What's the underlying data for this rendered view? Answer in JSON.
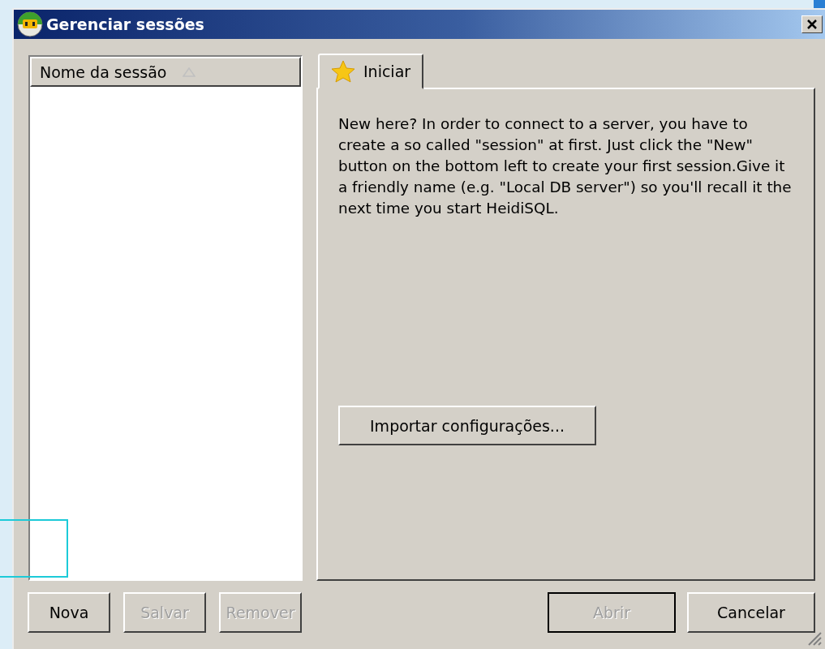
{
  "window": {
    "title": "Gerenciar sessões"
  },
  "session_list": {
    "columns": [
      {
        "label": "Nome da sessão",
        "sorted_ascending": true
      }
    ]
  },
  "tabs": [
    {
      "label": "Iniciar",
      "selected": true
    }
  ],
  "intro_text": "New here? In order to connect to a server, you have to create a so called \"session\" at first. Just click the \"New\" button on the bottom left to create your first session.Give it a friendly name (e.g. \"Local DB server\") so you'll recall it the next time you start HeidiSQL.",
  "import_button": {
    "label": "Importar configurações..."
  },
  "left_buttons": [
    {
      "label": "Nova",
      "disabled": false
    },
    {
      "label": "Salvar",
      "disabled": true
    },
    {
      "label": "Remover",
      "disabled": true
    }
  ],
  "right_buttons": [
    {
      "label": "Abrir",
      "disabled": true,
      "default": true
    },
    {
      "label": "Cancelar",
      "disabled": false,
      "default": false
    }
  ]
}
